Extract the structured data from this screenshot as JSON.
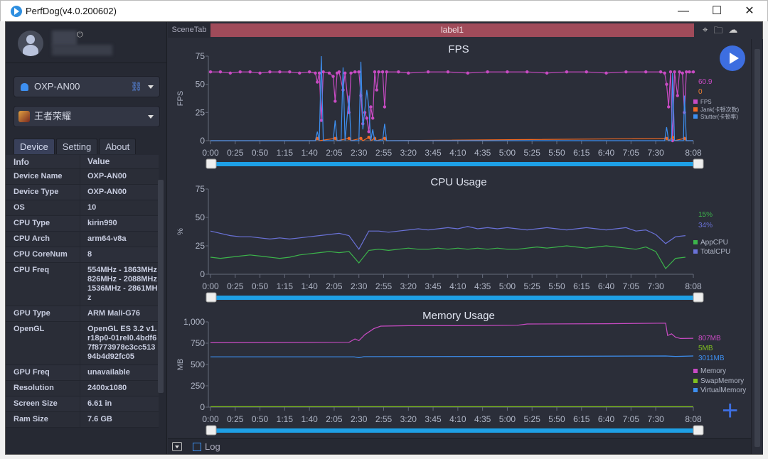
{
  "window": {
    "title": "PerfDog(v4.0.200602)",
    "minimize": "—",
    "maximize": "☐",
    "close": "✕"
  },
  "sidebar": {
    "device_select": "OXP-AN00",
    "app_select": "王者荣耀",
    "tabs": [
      "Device",
      "Setting",
      "About"
    ],
    "active_tab": "Device",
    "table_headers": [
      "Info",
      "Value"
    ],
    "rows": [
      [
        "Device Name",
        "OXP-AN00"
      ],
      [
        "Device Type",
        "OXP-AN00"
      ],
      [
        "OS",
        "10"
      ],
      [
        "CPU Type",
        "kirin990"
      ],
      [
        "CPU Arch",
        "arm64-v8a"
      ],
      [
        "CPU CoreNum",
        "8"
      ],
      [
        "CPU Freq",
        "554MHz - 1863MHz 826MHz - 2088MHz 1536MHz - 2861MHz"
      ],
      [
        "GPU Type",
        "ARM Mali-G76"
      ],
      [
        "OpenGL",
        "OpenGL ES 3.2 v1.r18p0-01rel0.4bdf67f8773978c3cc51394b4d92fc05"
      ],
      [
        "GPU Freq",
        "unavailable"
      ],
      [
        "Resolution",
        "2400x1080"
      ],
      [
        "Screen Size",
        "6.61 in"
      ],
      [
        "Ram Size",
        "7.6 GB"
      ]
    ]
  },
  "main": {
    "scene_tab": "SceneTab",
    "label": "label1",
    "log_label": "Log",
    "icons": [
      "location-icon",
      "folder-icon",
      "cloud-icon",
      "play-icon",
      "plus-icon"
    ]
  },
  "chart_data": [
    {
      "type": "line",
      "title": "FPS",
      "ylabel": "FPS",
      "ylim": [
        0,
        75
      ],
      "yticks": [
        "0",
        "25",
        "50",
        "75"
      ],
      "xlim": [
        "0:00",
        "8:08"
      ],
      "xticks": [
        "0:00",
        "0:25",
        "0:50",
        "1:15",
        "1:40",
        "2:05",
        "2:30",
        "2:55",
        "3:20",
        "3:45",
        "4:10",
        "4:35",
        "5:00",
        "5:25",
        "5:50",
        "6:15",
        "6:40",
        "7:05",
        "7:30",
        "8:08"
      ],
      "current": [
        {
          "text": "60.9",
          "color": "#c94bc4"
        },
        {
          "text": "0",
          "color": "#f08030"
        }
      ],
      "series": [
        {
          "name": "FPS",
          "color": "#c94bc4",
          "markers": true,
          "points": [
            [
              0,
              61
            ],
            [
              10,
              61
            ],
            [
              20,
              60
            ],
            [
              30,
              61
            ],
            [
              40,
              61
            ],
            [
              50,
              60
            ],
            [
              60,
              61
            ],
            [
              70,
              61
            ],
            [
              80,
              61
            ],
            [
              90,
              60
            ],
            [
              100,
              61
            ],
            [
              106,
              60
            ],
            [
              108,
              52
            ],
            [
              110,
              60
            ],
            [
              112,
              18
            ],
            [
              114,
              61
            ],
            [
              120,
              60
            ],
            [
              124,
              57
            ],
            [
              126,
              35
            ],
            [
              128,
              60
            ],
            [
              130,
              61
            ],
            [
              134,
              45
            ],
            [
              136,
              60
            ],
            [
              140,
              25
            ],
            [
              142,
              60
            ],
            [
              146,
              61
            ],
            [
              150,
              61
            ],
            [
              152,
              40
            ],
            [
              154,
              15
            ],
            [
              156,
              25
            ],
            [
              158,
              20
            ],
            [
              160,
              8
            ],
            [
              162,
              30
            ],
            [
              164,
              20
            ],
            [
              166,
              61
            ],
            [
              168,
              45
            ],
            [
              170,
              61
            ],
            [
              174,
              61
            ],
            [
              176,
              30
            ],
            [
              178,
              61
            ],
            [
              190,
              61
            ],
            [
              200,
              60
            ],
            [
              220,
              61
            ],
            [
              240,
              61
            ],
            [
              260,
              60
            ],
            [
              280,
              61
            ],
            [
              300,
              61
            ],
            [
              320,
              61
            ],
            [
              340,
              60
            ],
            [
              360,
              61
            ],
            [
              380,
              61
            ],
            [
              400,
              60
            ],
            [
              420,
              61
            ],
            [
              440,
              61
            ],
            [
              455,
              61
            ],
            [
              459,
              60
            ],
            [
              461,
              50
            ],
            [
              463,
              30
            ],
            [
              465,
              61
            ],
            [
              467,
              0
            ],
            [
              469,
              61
            ],
            [
              472,
              40
            ],
            [
              474,
              61
            ],
            [
              477,
              60
            ],
            [
              479,
              25
            ],
            [
              481,
              61
            ],
            [
              484,
              61
            ],
            [
              488,
              61
            ]
          ]
        },
        {
          "name": "Jank(卡顿次数)",
          "color": "#f06a25",
          "markers": true,
          "points": [
            [
              0,
              0
            ],
            [
              106,
              0
            ],
            [
              108,
              2
            ],
            [
              110,
              0
            ],
            [
              126,
              2
            ],
            [
              128,
              0
            ],
            [
              140,
              2
            ],
            [
              142,
              0
            ],
            [
              152,
              2
            ],
            [
              154,
              0
            ],
            [
              160,
              3
            ],
            [
              162,
              0
            ],
            [
              166,
              2
            ],
            [
              168,
              0
            ],
            [
              176,
              2
            ],
            [
              178,
              0
            ],
            [
              461,
              2
            ],
            [
              463,
              0
            ],
            [
              467,
              3
            ],
            [
              469,
              0
            ],
            [
              479,
              2
            ],
            [
              481,
              0
            ],
            [
              488,
              0
            ]
          ]
        },
        {
          "name": "Stutter(卡顿率)",
          "color": "#3d8ff0",
          "markers": false,
          "points": [
            [
              0,
              0
            ],
            [
              106,
              0
            ],
            [
              108,
              8
            ],
            [
              110,
              0
            ],
            [
              112,
              75
            ],
            [
              114,
              0
            ],
            [
              124,
              0
            ],
            [
              126,
              18
            ],
            [
              128,
              0
            ],
            [
              132,
              0
            ],
            [
              134,
              65
            ],
            [
              136,
              0
            ],
            [
              140,
              40
            ],
            [
              142,
              0
            ],
            [
              150,
              0
            ],
            [
              152,
              70
            ],
            [
              154,
              10
            ],
            [
              158,
              45
            ],
            [
              160,
              30
            ],
            [
              162,
              0
            ],
            [
              164,
              10
            ],
            [
              166,
              0
            ],
            [
              174,
              0
            ],
            [
              176,
              15
            ],
            [
              178,
              0
            ],
            [
              459,
              0
            ],
            [
              461,
              12
            ],
            [
              463,
              0
            ],
            [
              466,
              0
            ],
            [
              467,
              60
            ],
            [
              469,
              0
            ],
            [
              478,
              0
            ],
            [
              479,
              40
            ],
            [
              481,
              0
            ],
            [
              488,
              0
            ]
          ]
        }
      ]
    },
    {
      "type": "line",
      "title": "CPU Usage",
      "ylabel": "%",
      "ylim": [
        0,
        75
      ],
      "yticks": [
        "0",
        "25",
        "50",
        "75"
      ],
      "xlim": [
        "0:00",
        "8:08"
      ],
      "current": [
        {
          "text": "15%",
          "color": "#3cb44b"
        },
        {
          "text": "34%",
          "color": "#6a72d8"
        }
      ],
      "series": [
        {
          "name": "AppCPU",
          "color": "#3cb44b",
          "values_every_10s": [
            15,
            14,
            15,
            16,
            17,
            16,
            15,
            14,
            15,
            17,
            18,
            19,
            20,
            19,
            20,
            10,
            21,
            22,
            21,
            22,
            23,
            22,
            22,
            23,
            22,
            23,
            22,
            23,
            22,
            23,
            22,
            22,
            23,
            24,
            23,
            24,
            25,
            24,
            23,
            24,
            25,
            24,
            23,
            22,
            24,
            20,
            5,
            14,
            15
          ]
        },
        {
          "name": "TotalCPU",
          "color": "#6a72d8",
          "values_every_10s": [
            38,
            36,
            34,
            33,
            33,
            32,
            31,
            32,
            31,
            32,
            33,
            34,
            35,
            36,
            34,
            22,
            38,
            38,
            37,
            38,
            39,
            40,
            39,
            40,
            41,
            40,
            42,
            40,
            41,
            40,
            41,
            40,
            39,
            40,
            41,
            40,
            39,
            40,
            41,
            40,
            39,
            40,
            41,
            38,
            39,
            35,
            27,
            33,
            34
          ]
        }
      ]
    },
    {
      "type": "line",
      "title": "Memory Usage",
      "ylabel": "MB",
      "ylim": [
        0,
        1000
      ],
      "yticks": [
        "0",
        "250",
        "500",
        "750",
        "1,000"
      ],
      "xlim": [
        "0:00",
        "8:08"
      ],
      "current": [
        {
          "text": "807MB",
          "color": "#c94bc4"
        },
        {
          "text": "5MB",
          "color": "#7fbf1f"
        },
        {
          "text": "3011MB",
          "color": "#3d8ff0"
        }
      ],
      "series": [
        {
          "name": "Memory",
          "color": "#c94bc4",
          "points": [
            [
              0,
              755
            ],
            [
              140,
              760
            ],
            [
              146,
              800
            ],
            [
              150,
              780
            ],
            [
              156,
              850
            ],
            [
              165,
              920
            ],
            [
              172,
              950
            ],
            [
              200,
              955
            ],
            [
              250,
              955
            ],
            [
              310,
              960
            ],
            [
              320,
              975
            ],
            [
              400,
              978
            ],
            [
              460,
              985
            ],
            [
              462,
              840
            ],
            [
              466,
              860
            ],
            [
              470,
              820
            ],
            [
              475,
              805
            ],
            [
              488,
              807
            ]
          ]
        },
        {
          "name": "SwapMemory",
          "color": "#7fbf1f",
          "points": [
            [
              0,
              5
            ],
            [
              488,
              5
            ]
          ]
        },
        {
          "name": "VirtualMemory",
          "color": "#3d8ff0",
          "points": [
            [
              0,
              590
            ],
            [
              145,
              590
            ],
            [
              150,
              580
            ],
            [
              155,
              592
            ],
            [
              300,
              595
            ],
            [
              460,
              600
            ],
            [
              470,
              595
            ],
            [
              488,
              600
            ]
          ]
        }
      ]
    }
  ]
}
